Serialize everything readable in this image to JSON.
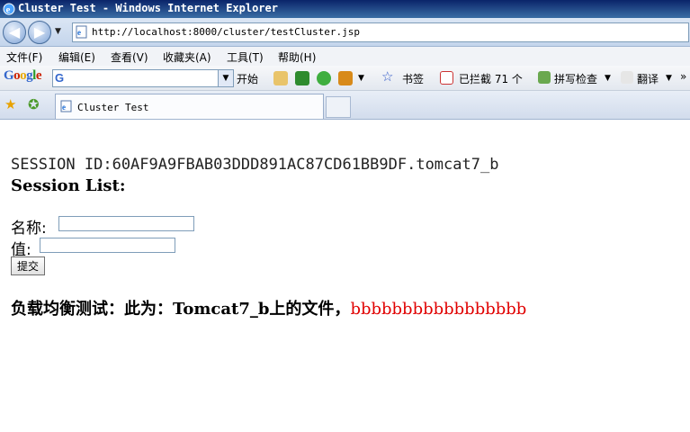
{
  "window": {
    "title": "Cluster Test - Windows Internet Explorer"
  },
  "address": {
    "url": "http://localhost:8000/cluster/testCluster.jsp"
  },
  "menu": {
    "items": [
      "文件(F)",
      "编辑(E)",
      "查看(V)",
      "收藏夹(A)",
      "工具(T)",
      "帮助(H)"
    ]
  },
  "google_toolbar": {
    "logo": "Google",
    "search_prefix": "G",
    "start_label": "开始",
    "bookmarks_label": "书签",
    "blocked_label": "已拦截 71 个",
    "spellcheck_label": "拼写检查",
    "translate_label": "翻译"
  },
  "tabs": {
    "active_label": "Cluster Test"
  },
  "page": {
    "session_id": "SESSION ID:60AF9A9FBAB03DDD891AC87CD61BB9DF.tomcat7_b",
    "session_list_label": "Session List:",
    "name_label": "名称:",
    "name_value": "",
    "value_label": "值:",
    "value_value": "",
    "submit_label": "提交",
    "lb_text": "负载均衡测试：此为：Tomcat7_b上的文件，",
    "lb_highlight": "bbbbbbbbbbbbbbbbb"
  },
  "colors": {
    "highlight": "#e00000",
    "titlebar": "#0a246a"
  }
}
